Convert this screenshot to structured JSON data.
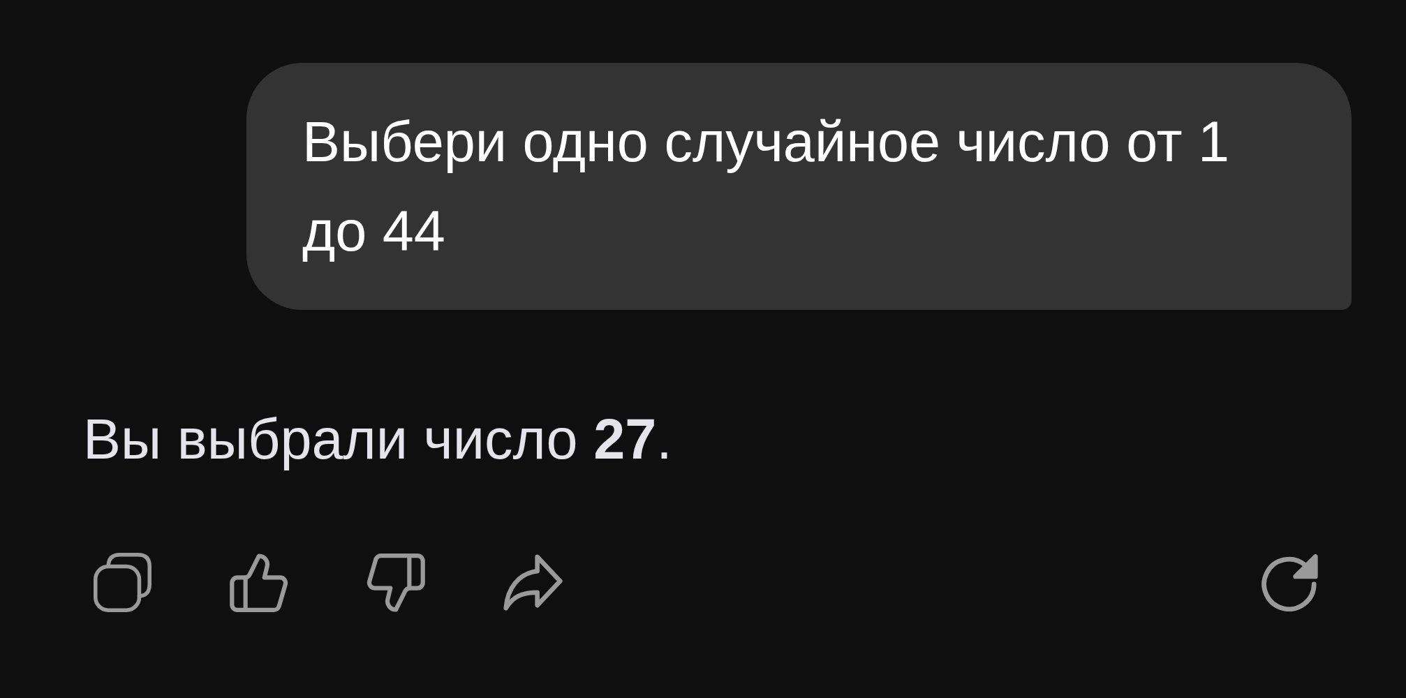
{
  "chat": {
    "messages": [
      {
        "kind": "user",
        "text": "Выбери одно случайное число от 1 до 44"
      },
      {
        "kind": "assistant",
        "text": "Вы выбрали число **27**."
      }
    ]
  }
}
